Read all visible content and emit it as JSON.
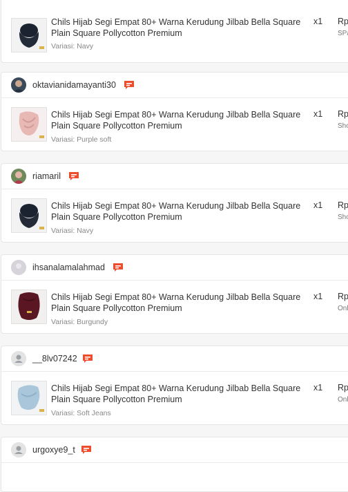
{
  "colors": {
    "chat_icon": "#ee4d2d",
    "navy": "#1c2330",
    "pink": "#e7b8b4",
    "burgundy": "#5a1622",
    "soft_jeans": "#a9c6db"
  },
  "orders": [
    {
      "username": "",
      "avatar_icon": "avatar-photo-icon",
      "item": {
        "title": "Chils Hijab Segi Empat 80+ Warna Kerudung Jilbab Bella Square Plain Square Pollycotton Premium",
        "variant": "Variasi: Navy",
        "qty": "x1",
        "price": "Rp",
        "courier": "SPa",
        "product_color": "navy"
      }
    },
    {
      "username": "oktavianidamayanti30",
      "avatar_icon": "avatar-photo-icon",
      "item": {
        "title": "Chils Hijab Segi Empat 80+ Warna Kerudung Jilbab Bella Square Plain Square Pollycotton Premium",
        "variant": "Variasi: Purple soft",
        "qty": "x1",
        "price": "Rp",
        "courier": "Sho",
        "product_color": "pink"
      }
    },
    {
      "username": "riamaril",
      "avatar_icon": "avatar-photo-icon",
      "item": {
        "title": "Chils Hijab Segi Empat 80+ Warna Kerudung Jilbab Bella Square Plain Square Pollycotton Premium",
        "variant": "Variasi: Navy",
        "qty": "x1",
        "price": "Rp",
        "courier": "Sho",
        "product_color": "navy"
      }
    },
    {
      "username": "ihsanalamalahmad",
      "avatar_icon": "avatar-photo-icon",
      "item": {
        "title": "Chils Hijab Segi Empat 80+ Warna Kerudung Jilbab Bella Square Plain Square Pollycotton Premium",
        "variant": "Variasi: Burgundy",
        "qty": "x1",
        "price": "Rp",
        "courier": "Onl",
        "product_color": "burgundy"
      }
    },
    {
      "username": "__8lv07242",
      "avatar_icon": "default-user-avatar-icon",
      "item": {
        "title": "Chils Hijab Segi Empat 80+ Warna Kerudung Jilbab Bella Square Plain Square Pollycotton Premium",
        "variant": "Variasi: Soft Jeans",
        "qty": "x1",
        "price": "Rp",
        "courier": "Onl",
        "product_color": "soft_jeans"
      }
    },
    {
      "username": "urgoxye9_t",
      "avatar_icon": "default-user-avatar-icon",
      "item": null
    }
  ]
}
